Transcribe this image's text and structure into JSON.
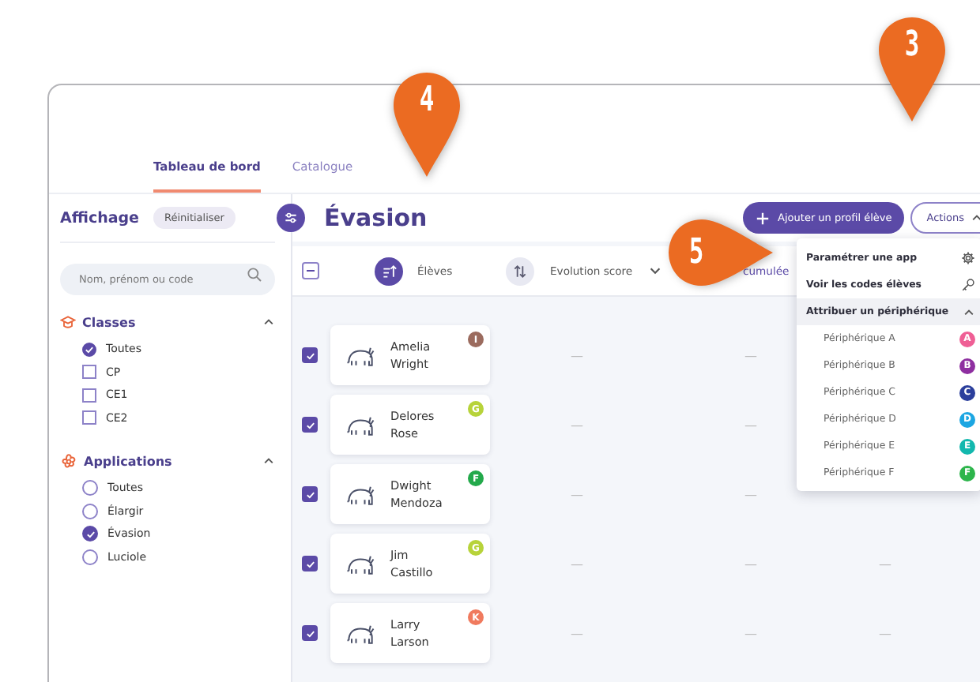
{
  "tabs": [
    {
      "label": "Tableau de bord",
      "selected": true
    },
    {
      "label": "Catalogue",
      "selected": false
    }
  ],
  "sidebar": {
    "title": "Affichage",
    "reset_button": "Réinitialiser",
    "search": {
      "placeholder": "Nom, prénom ou code"
    },
    "sections": [
      {
        "title": "Classes",
        "kind": "checkbox",
        "expanded": true,
        "options": [
          {
            "label": "Toutes",
            "checked": true
          },
          {
            "label": "CP",
            "checked": false
          },
          {
            "label": "CE1",
            "checked": false
          },
          {
            "label": "CE2",
            "checked": false
          }
        ]
      },
      {
        "title": "Applications",
        "kind": "radio",
        "expanded": true,
        "options": [
          {
            "label": "Toutes",
            "selected": false
          },
          {
            "label": "Élargir",
            "selected": false
          },
          {
            "label": "Évasion",
            "selected": true
          },
          {
            "label": "Luciole",
            "selected": false
          }
        ]
      }
    ]
  },
  "main": {
    "title": "Évasion",
    "add_button": "Ajouter un profil élève",
    "actions_button": {
      "label": "Actions",
      "expanded": true
    },
    "select_all": {
      "mixed": true
    },
    "columns": [
      {
        "label": "Élèves",
        "sorted": true
      },
      {
        "label": "Evolution score",
        "sorted": false
      },
      {
        "label": "cumulée"
      }
    ],
    "rows": [
      {
        "first_name": "Amelia",
        "last_name": "Wright",
        "checked": true,
        "badge": "I",
        "color": "#9b6b5e",
        "values": [
          "—",
          "—"
        ]
      },
      {
        "first_name": "Delores",
        "last_name": "Rose",
        "checked": true,
        "badge": "G",
        "color": "#b7d33a",
        "values": [
          "—",
          "—"
        ]
      },
      {
        "first_name": "Dwight",
        "last_name": "Mendoza",
        "checked": true,
        "badge": "F",
        "color": "#23a94b",
        "values": [
          "—",
          "—"
        ]
      },
      {
        "first_name": "Jim",
        "last_name": "Castillo",
        "checked": true,
        "badge": "G",
        "color": "#b7d33a",
        "values": [
          "—",
          "—",
          "—"
        ]
      },
      {
        "first_name": "Larry",
        "last_name": "Larson",
        "checked": true,
        "badge": "K",
        "color": "#f07a5e",
        "values": [
          "—",
          "—",
          "—"
        ]
      }
    ]
  },
  "actions_menu": {
    "items": [
      {
        "kind": "gear",
        "label": "Paramétrer une app"
      },
      {
        "kind": "key",
        "label": "Voir les codes élèves"
      },
      {
        "kind": "group",
        "label": "Attribuer un périphérique",
        "expanded": true,
        "children": [
          {
            "label": "Périphérique A",
            "badge": "A",
            "color": "#ef5f95"
          },
          {
            "label": "Périphérique B",
            "badge": "B",
            "color": "#8e2fa0"
          },
          {
            "label": "Périphérique C",
            "badge": "C",
            "color": "#2b3f9c"
          },
          {
            "label": "Périphérique D",
            "badge": "D",
            "color": "#1ca6e2"
          },
          {
            "label": "Périphérique E",
            "badge": "E",
            "color": "#13b8ae"
          },
          {
            "label": "Périphérique F",
            "badge": "F",
            "color": "#2db54b"
          }
        ]
      }
    ]
  },
  "markers": [
    {
      "label": "4"
    },
    {
      "label": "3"
    },
    {
      "label": "5"
    }
  ]
}
